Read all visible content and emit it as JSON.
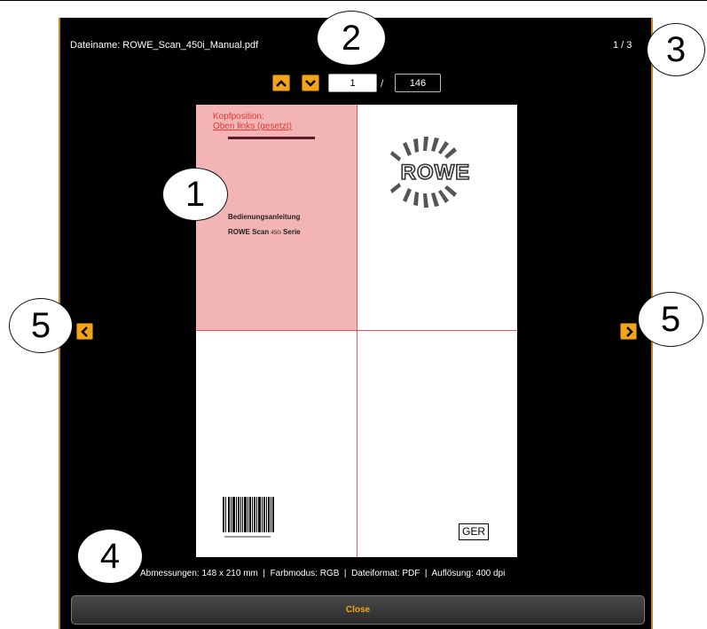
{
  "viewer": {
    "filename": "Dateiname: ROWE_Scan_450i_Manual.pdf",
    "page_of_docs": "1 / 3",
    "current_page": "1",
    "page_separator": "/",
    "total_pages": "146",
    "close_label": "Close",
    "metadata": "Abmessungen: 148 x 210 mm  |  Farbmodus: RGB  |  Dateiformat: PDF  |  Auflösung: 400 dpi",
    "accent_color": "#f2a51a"
  },
  "document": {
    "head_position_label": "Kopfposition:",
    "head_position_value": "Oben links (gesetzt)",
    "manual_title": "Bedienungsanleitung",
    "product_prefix": "ROWE Scan",
    "product_model": "450i",
    "product_suffix": "Serie",
    "logo_text": "ROWE",
    "language_tag": "GER"
  },
  "callouts": [
    "1",
    "2",
    "3",
    "4",
    "5",
    "5"
  ]
}
